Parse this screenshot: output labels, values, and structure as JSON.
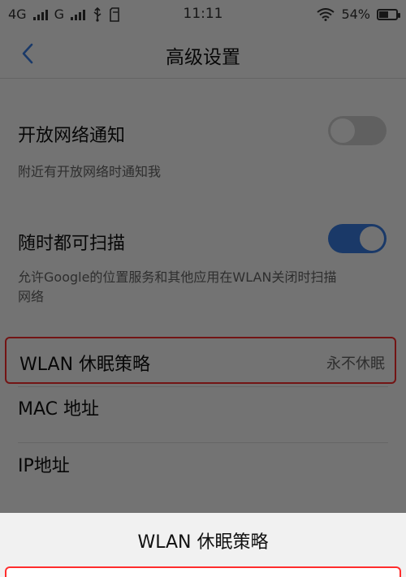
{
  "status_bar": {
    "network1": "4G",
    "network2": "G",
    "time": "11:11",
    "battery": "54%",
    "battery_level": 0.54
  },
  "header": {
    "title": "高级设置",
    "back_icon": "chevron-left-icon"
  },
  "settings": {
    "open_network_notify": {
      "title": "开放网络通知",
      "description": "附近有开放网络时通知我",
      "enabled": false
    },
    "always_scan": {
      "title": "随时都可扫描",
      "description_line1": "允许Google的位置服务和其他应用在WLAN关闭时扫描",
      "description_line2": "网络",
      "enabled": true
    },
    "wlan_sleep_policy": {
      "label": "WLAN 休眠策略",
      "value": "永不休眠"
    },
    "mac_address": {
      "label": "MAC 地址"
    },
    "ip_address": {
      "label": "IP地址"
    }
  },
  "sheet": {
    "title": "WLAN 休眠策略"
  },
  "colors": {
    "accent_blue": "#3a7fe6",
    "highlight_red": "#ff2d2d",
    "toggle_off": "#d6d6d6"
  }
}
